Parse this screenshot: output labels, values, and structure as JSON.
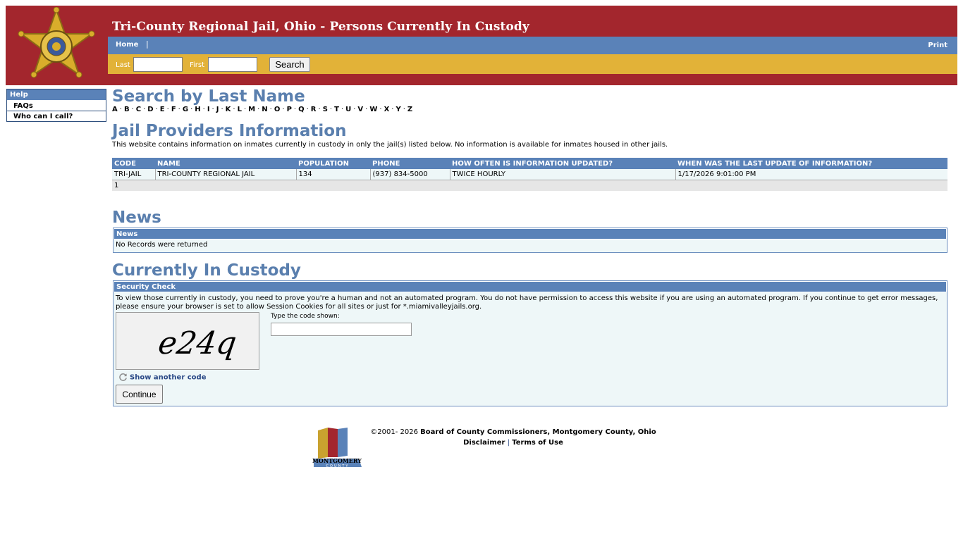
{
  "header": {
    "title": "Tri-County Regional Jail, Ohio - Persons Currently In Custody",
    "nav": {
      "home": "Home",
      "separator": "|",
      "print": "Print"
    },
    "search": {
      "last_label": "Last",
      "first_label": "First",
      "button": "Search"
    },
    "colors": {
      "banner": "#a3262d",
      "nav": "#5a82b8",
      "search_bar": "#e2b238"
    }
  },
  "sidebar": {
    "heading": "Help",
    "items": [
      {
        "label": "FAQs"
      },
      {
        "label": "Who can I call?"
      }
    ]
  },
  "main": {
    "search_heading": "Search by Last Name",
    "letters": [
      "A",
      "B",
      "C",
      "D",
      "E",
      "F",
      "G",
      "H",
      "I",
      "J",
      "K",
      "L",
      "M",
      "N",
      "O",
      "P",
      "Q",
      "R",
      "S",
      "T",
      "U",
      "V",
      "W",
      "X",
      "Y",
      "Z"
    ],
    "providers_heading": "Jail Providers Information",
    "providers_text": "This website contains information on inmates currently in custody in only the jail(s) listed below. No information is available for inmates housed in other jails.",
    "providers_table": {
      "columns": [
        "CODE",
        "NAME",
        "POPULATION",
        "PHONE",
        "HOW OFTEN IS INFORMATION UPDATED?",
        "WHEN WAS THE LAST UPDATE OF INFORMATION?"
      ],
      "rows": [
        [
          "TRI-JAIL",
          "TRI-COUNTY REGIONAL JAIL",
          "134",
          "(937) 834-5000",
          "TWICE HOURLY",
          "1/17/2026 9:01:00 PM"
        ]
      ],
      "pager": "1"
    },
    "news_heading": "News",
    "news_box": {
      "header": "News",
      "text": "No Records were returned"
    },
    "custody_heading": "Currently In Custody",
    "security": {
      "header": "Security Check",
      "text": "To view those currently in custody, you need to prove you're a human and not an automated program. You do not have permission to access this website if you are using an automated program. If you continue to get error messages, please ensure your browser is set to allow Session Cookies for all sites or just for *.miamivalleyjails.org.",
      "captcha_code": "e24q",
      "input_label": "Type the code shown:",
      "refresh_label": "Show another code",
      "continue_label": "Continue"
    }
  },
  "footer": {
    "copyright_prefix": "©2001- 2026",
    "owner": "Board of County Commissioners, Montgomery County, Ohio",
    "disclaimer": "Disclaimer",
    "separator": "|",
    "terms": "Terms of Use",
    "logo_text": "MONTGOMERY",
    "logo_subtext": "COUNTY"
  }
}
